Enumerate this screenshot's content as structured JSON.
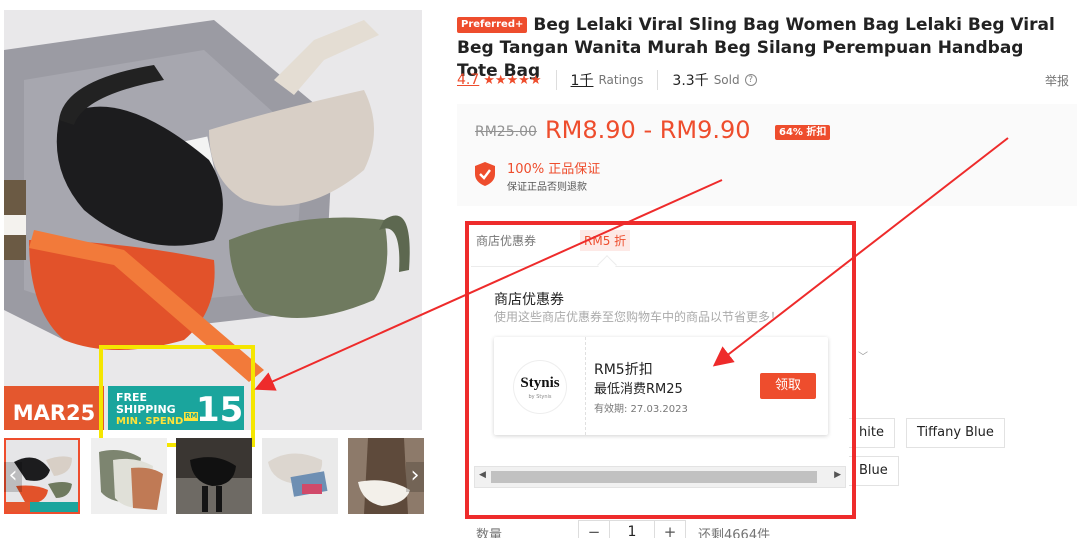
{
  "gallery": {
    "promo_label": "MAR25",
    "shipping_badge": {
      "line1": "FREE",
      "line2": "SHIPPING",
      "line3": "MIN. SPEND",
      "currency": "RM",
      "amount": "15"
    },
    "thumbnail_count": 5
  },
  "product": {
    "preferred_tag": "Preferred+",
    "title": "Beg Lelaki Viral Sling Bag Women Bag Lelaki Beg Viral Beg Tangan Wanita Murah Beg Silang Perempuan Handbag Tote Bag",
    "rating": "4.7",
    "stars": "★★★★★",
    "ratings_count": "1千",
    "ratings_label": "Ratings",
    "sold_count": "3.3千",
    "sold_label": "Sold",
    "report": "举报"
  },
  "price": {
    "original": "RM25.00",
    "current": "RM8.90 - RM9.90",
    "discount": "64% 折扣",
    "guarantee_title": "100% 正品保证",
    "guarantee_sub": "保证正品否则退款"
  },
  "voucher": {
    "section_label": "商店优惠券",
    "chip": "RM5 折",
    "popover_title": "商店优惠券",
    "popover_subtitle": "使用这些商店优惠券至您购物车中的商品以节省更多！",
    "card": {
      "logo_text": "Stynis",
      "logo_small": "by Stynis",
      "amount": "RM5折扣",
      "min_spend": "最低消费RM25",
      "expiry": "有效期: 27.03.2023",
      "claim_button": "领取"
    }
  },
  "variations": {
    "options": [
      "hite",
      "Tiffany Blue",
      "Blue"
    ]
  },
  "quantity": {
    "label": "数量",
    "value": "1",
    "minus": "−",
    "plus": "+",
    "stock": "还剩4664件"
  },
  "colors": {
    "accent": "#ee4d2d",
    "annotation_red": "#ee2b2b",
    "annotation_yellow": "#f5e600",
    "badge_teal": "#1aa59d"
  }
}
